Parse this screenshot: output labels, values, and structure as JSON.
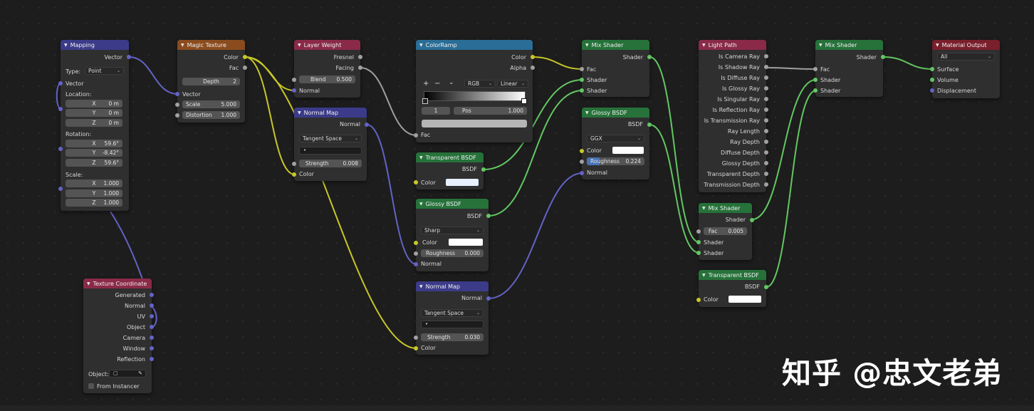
{
  "nodes": {
    "mapping": {
      "title": "Mapping",
      "out_vector": "Vector",
      "type_label": "Type:",
      "type_value": "Point",
      "in_vector": "Vector",
      "location_label": "Location:",
      "loc_x_label": "X",
      "loc_x": "0 m",
      "loc_y_label": "Y",
      "loc_y": "0 m",
      "loc_z_label": "Z",
      "loc_z": "0 m",
      "rotation_label": "Rotation:",
      "rot_x_label": "X",
      "rot_x": "59.6°",
      "rot_y_label": "Y",
      "rot_y": "-8.42°",
      "rot_z_label": "Z",
      "rot_z": "59.6°",
      "scale_label": "Scale:",
      "sc_x_label": "X",
      "sc_x": "1.000",
      "sc_y_label": "Y",
      "sc_y": "1.000",
      "sc_z_label": "Z",
      "sc_z": "1.000"
    },
    "texture_coordinate": {
      "title": "Texture Coordinate",
      "outputs": [
        "Generated",
        "Normal",
        "UV",
        "Object",
        "Camera",
        "Window",
        "Reflection"
      ],
      "object_label": "Object:",
      "from_instancer": "From Instancer"
    },
    "magic_texture": {
      "title": "Magic Texture",
      "out_color": "Color",
      "out_fac": "Fac",
      "depth_label": "Depth",
      "depth_value": "2",
      "in_vector": "Vector",
      "scale_label": "Scale",
      "scale_value": "5.000",
      "distortion_label": "Distortion",
      "distortion_value": "1.000"
    },
    "layer_weight": {
      "title": "Layer Weight",
      "out_fresnel": "Fresnel",
      "out_facing": "Facing",
      "blend_label": "Blend",
      "blend_value": "0.500",
      "in_normal": "Normal"
    },
    "normal_map_1": {
      "title": "Normal Map",
      "out_normal": "Normal",
      "space": "Tangent Space",
      "uv_value": "•",
      "strength_label": "Strength",
      "strength_value": "0.008",
      "in_color": "Color"
    },
    "color_ramp": {
      "title": "ColorRamp",
      "out_color": "Color",
      "out_alpha": "Alpha",
      "add": "+",
      "remove": "−",
      "menu": "⌄",
      "mode": "RGB",
      "interp": "Linear",
      "index": "1",
      "pos_label": "Pos",
      "pos_value": "1.000",
      "in_fac": "Fac"
    },
    "transparent_bsdf_1": {
      "title": "Transparent BSDF",
      "out_bsdf": "BSDF",
      "color_label": "Color",
      "color": "#e6f0ff"
    },
    "glossy_bsdf_1": {
      "title": "Glossy BSDF",
      "out_bsdf": "BSDF",
      "distribution": "Sharp",
      "color_label": "Color",
      "roughness_label": "Roughness",
      "roughness_value": "0.000",
      "in_normal": "Normal"
    },
    "normal_map_2": {
      "title": "Normal Map",
      "out_normal": "Normal",
      "space": "Tangent Space",
      "uv_value": "•",
      "strength_label": "Strength",
      "strength_value": "0.030",
      "in_color": "Color"
    },
    "mix_shader_1": {
      "title": "Mix Shader",
      "out_shader": "Shader",
      "in_fac": "Fac",
      "in_shader_a": "Shader",
      "in_shader_b": "Shader"
    },
    "glossy_bsdf_2": {
      "title": "Glossy BSDF",
      "out_bsdf": "BSDF",
      "distribution": "GGX",
      "color_label": "Color",
      "roughness_label": "Roughness",
      "roughness_value": "0.224",
      "roughness_fraction": 0.224,
      "in_normal": "Normal"
    },
    "light_path": {
      "title": "Light Path",
      "outputs": [
        "Is Camera Ray",
        "Is Shadow Ray",
        "Is Diffuse Ray",
        "Is Glossy Ray",
        "Is Singular Ray",
        "Is Reflection Ray",
        "Is Transmission Ray",
        "Ray Length",
        "Ray Depth",
        "Diffuse Depth",
        "Glossy Depth",
        "Transparent Depth",
        "Transmission Depth"
      ]
    },
    "mix_shader_2": {
      "title": "Mix Shader",
      "out_shader": "Shader",
      "fac_label": "Fac",
      "fac_value": "0.005",
      "in_shader_a": "Shader",
      "in_shader_b": "Shader"
    },
    "transparent_bsdf_2": {
      "title": "Transparent BSDF",
      "out_bsdf": "BSDF",
      "color_label": "Color",
      "color": "#ffffff"
    },
    "mix_shader_3": {
      "title": "Mix Shader",
      "out_shader": "Shader",
      "in_fac": "Fac",
      "in_shader_a": "Shader",
      "in_shader_b": "Shader"
    },
    "material_output": {
      "title": "Material Output",
      "target": "All",
      "in_surface": "Surface",
      "in_volume": "Volume",
      "in_displacement": "Displacement"
    }
  },
  "watermark": "知乎 @忠文老弟",
  "colors": {
    "vector_socket": "#6363c7",
    "color_socket": "#c7c729",
    "float_socket": "#a1a1a1",
    "shader_socket": "#63c763"
  }
}
